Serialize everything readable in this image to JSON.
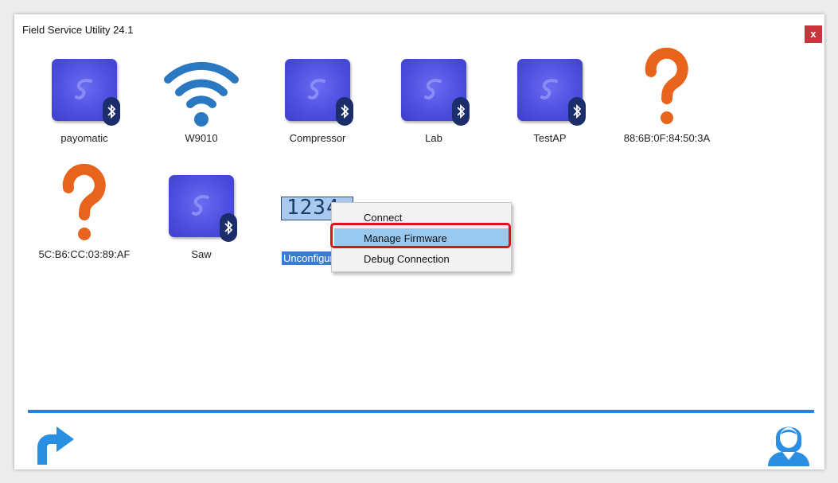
{
  "window": {
    "title": "Field Service Utility 24.1",
    "close_label": "x"
  },
  "devices": [
    {
      "label": "payomatic",
      "icon": "device-bluetooth-icon"
    },
    {
      "label": "W9010",
      "icon": "wifi-icon"
    },
    {
      "label": "Compressor",
      "icon": "device-bluetooth-icon"
    },
    {
      "label": "Lab",
      "icon": "device-bluetooth-icon"
    },
    {
      "label": "TestAP",
      "icon": "device-bluetooth-icon"
    },
    {
      "label": "88:6B:0F:84:50:3A",
      "icon": "unknown-question-icon"
    },
    {
      "label": "5C:B6:CC:03:89:AF",
      "icon": "unknown-question-icon"
    },
    {
      "label": "Saw",
      "icon": "device-bluetooth-icon"
    },
    {
      "label": "Unconfigured",
      "icon": "lcd-display-icon",
      "lcd_text": "1234"
    }
  ],
  "context_menu": {
    "items": [
      "Connect",
      "Manage Firmware",
      "Debug Connection"
    ],
    "highlighted_index": 1
  },
  "footer": {
    "refresh_icon": "refresh-arrow-icon",
    "support_icon": "support-agent-icon"
  },
  "colors": {
    "tile_blue": "#4f4fe0",
    "accent_blue": "#2e7fd6",
    "question_orange": "#e8641c",
    "highlight_red": "#e0101e",
    "menu_hover": "#99c9ef"
  }
}
